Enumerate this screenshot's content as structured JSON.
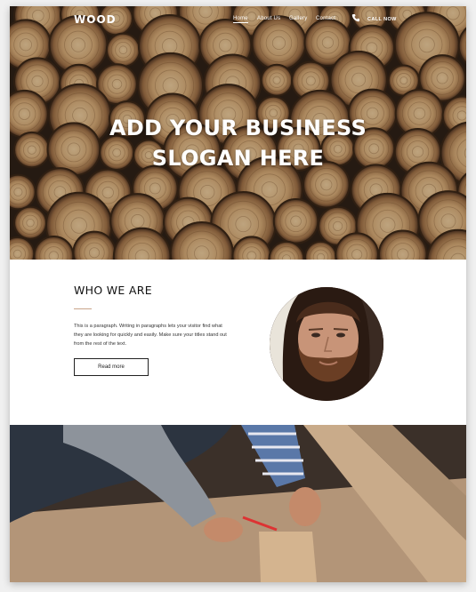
{
  "header": {
    "logo": "WOOD",
    "nav": [
      "Home",
      "About Us",
      "Gallery",
      "Contact"
    ],
    "active_nav": "Home",
    "call_label": "CALL NOW"
  },
  "hero": {
    "slogan_line1": "ADD YOUR BUSINESS",
    "slogan_line2": "SLOGAN HERE"
  },
  "about": {
    "title": "WHO WE ARE",
    "paragraph": "This is a paragraph. Writing in paragraphs lets your visitor find what they are looking for quickly and easily. Make sure your titles stand out from the rest of the text.",
    "button": "Read more"
  },
  "icons": {
    "phone": "phone-icon"
  },
  "colors": {
    "divider": "#c9a58a",
    "text": "#111111",
    "nav_text": "#ffffff"
  }
}
